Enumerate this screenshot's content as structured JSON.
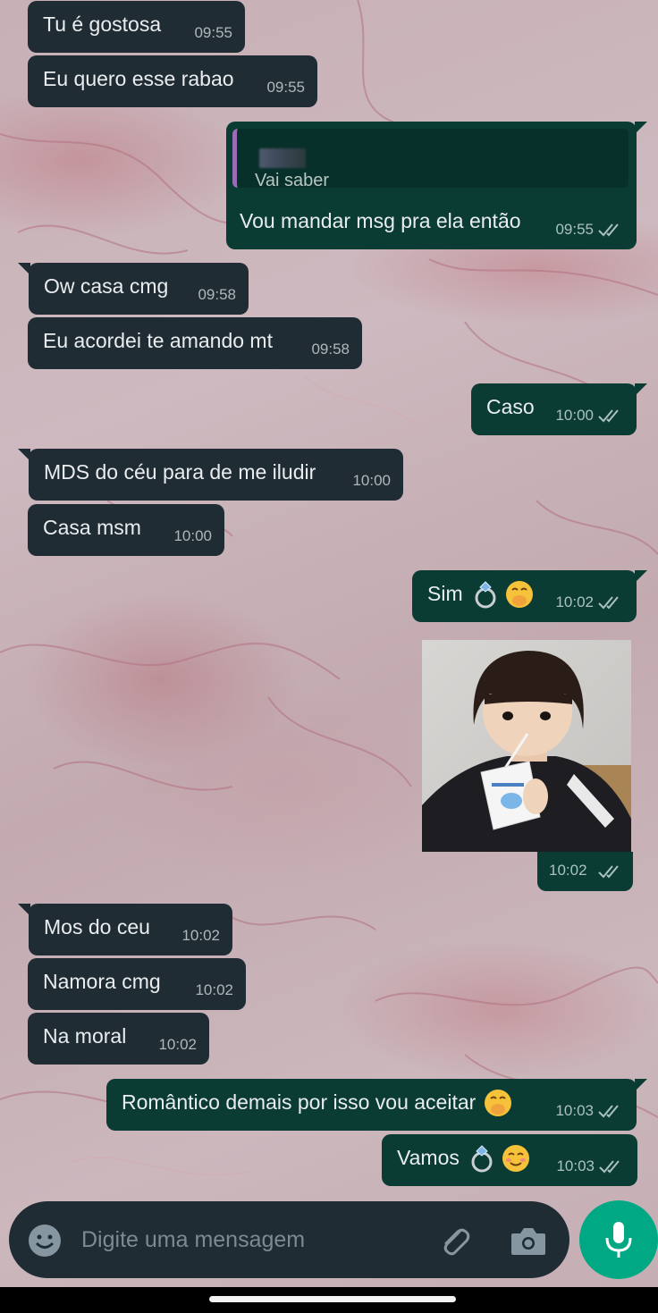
{
  "chat": {
    "messages": [
      {
        "text": "Tu é gostosa",
        "time": "09:55"
      },
      {
        "text": "Eu quero esse rabao",
        "time": "09:55"
      },
      {
        "quoted": "Vai saber",
        "text": "Vou mandar msg pra ela então",
        "time": "09:55"
      },
      {
        "text": "Ow casa cmg",
        "time": "09:58"
      },
      {
        "text": "Eu acordei te amando mt",
        "time": "09:58"
      },
      {
        "text": "Caso",
        "time": "10:00"
      },
      {
        "text": "MDS do céu para de me iludir",
        "time": "10:00"
      },
      {
        "text": "Casa msm",
        "time": "10:00"
      },
      {
        "text": "Sim",
        "time": "10:02"
      },
      {
        "image": "toddler-drinking-milk-carton",
        "time": "10:02"
      },
      {
        "text": "Mos do ceu",
        "time": "10:02"
      },
      {
        "text": "Namora cmg",
        "time": "10:02"
      },
      {
        "text": "Na moral",
        "time": "10:02"
      },
      {
        "text": "Romântico demais por isso vou aceitar",
        "time": "10:03"
      },
      {
        "text": "Vamos",
        "time": "10:03"
      }
    ]
  },
  "composer": {
    "placeholder": "Digite uma mensagem",
    "icons": [
      "emoji-icon",
      "attach-icon",
      "camera-icon",
      "mic-icon"
    ]
  },
  "colors": {
    "incoming_bubble": "#202c33",
    "outgoing_bubble": "#0b3c34",
    "accent": "#00a884"
  }
}
